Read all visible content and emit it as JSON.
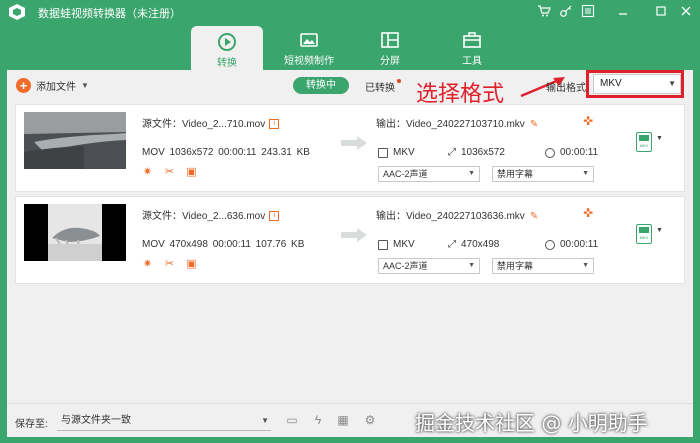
{
  "window": {
    "title": "数据蛙视频转换器（未注册）",
    "controls": [
      "cart-icon",
      "key-icon",
      "menu-icon",
      "minimize-icon",
      "maximize-icon",
      "close-icon"
    ]
  },
  "nav": {
    "tabs": [
      {
        "label": "转换",
        "icon": "convert-icon",
        "active": true
      },
      {
        "label": "短视频制作",
        "icon": "short-video-icon",
        "active": false
      },
      {
        "label": "分屏",
        "icon": "split-screen-icon",
        "active": false
      },
      {
        "label": "工具",
        "icon": "toolbox-icon",
        "active": false
      }
    ]
  },
  "toolbar": {
    "add_file_label": "添加文件",
    "converting_label": "转换中",
    "converted_label": "已转换",
    "annotation_text": "选择格式",
    "output_format_label": "输出格式:",
    "output_format_value": "MKV"
  },
  "files": [
    {
      "source_name": "源文件：Video_2...710.mov",
      "source_meta": "MOV  1036x572  00:00:11  243.31 KB",
      "output_name": "输出：Video_240227103710.mkv",
      "output_format": "MKV",
      "output_resolution": "1036x572",
      "output_duration": "00:00:11",
      "audio_track": "AAC-2声道",
      "subtitle": "禁用字幕",
      "format_badge_text": "MKV"
    },
    {
      "source_name": "源文件：Video_2...636.mov",
      "source_meta": "MOV  470x498  00:00:11  107.76 KB",
      "output_name": "输出：Video_240227103636.mkv",
      "output_format": "MKV",
      "output_resolution": "470x498",
      "output_duration": "00:00:11",
      "audio_track": "AAC-2声道",
      "subtitle": "禁用字幕",
      "format_badge_text": "MKV"
    }
  ],
  "bottom": {
    "save_to_label": "保存至:",
    "save_to_value": "与源文件夹一致",
    "watermark_text": "掘金技术社区 @ 小明助手"
  },
  "colors": {
    "brand_green": "#3aa56c",
    "accent_orange": "#f26b29",
    "annotation_red": "#e0202a"
  }
}
